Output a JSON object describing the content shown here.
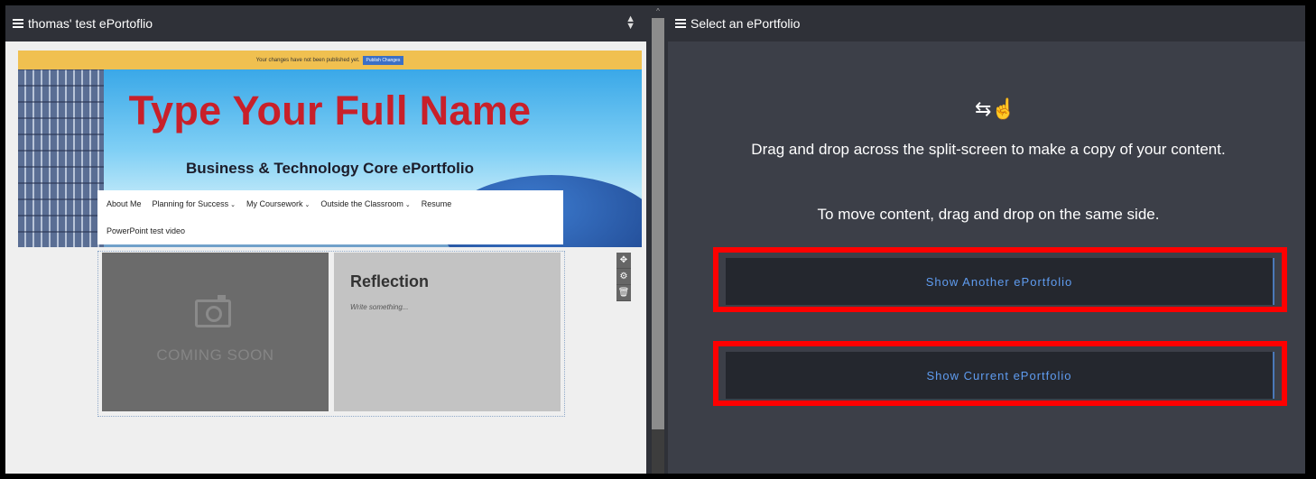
{
  "left_pane": {
    "title": "thomas' test ePortoflio",
    "publish_message": "Your changes have not been published yet.",
    "publish_button": "Publish Changes",
    "hero_title": "Type Your Full Name",
    "hero_subtitle": "Business & Technology Core ePortfolio",
    "nav": [
      {
        "label": "About Me",
        "dropdown": false
      },
      {
        "label": "Planning for Success",
        "dropdown": true
      },
      {
        "label": "My Coursework",
        "dropdown": true
      },
      {
        "label": "Outside the Classroom",
        "dropdown": true
      },
      {
        "label": "Resume",
        "dropdown": false
      },
      {
        "label": "PowerPoint test video",
        "dropdown": false
      }
    ],
    "image_placeholder": "COMING SOON",
    "reflection_title": "Reflection",
    "reflection_placeholder": "Write something..."
  },
  "right_pane": {
    "title": "Select an ePortfolio",
    "instruction_1": "Drag and drop across the split-screen to make a copy of your content.",
    "instruction_2": "To move content, drag and drop on the same side.",
    "button_another": "Show Another ePortfolio",
    "button_current": "Show Current ePortfolio"
  },
  "colors": {
    "highlight": "#ff0000",
    "link_blue": "#5f9cf0",
    "hero_title_red": "#c8202a",
    "publish_bar": "#f0c050"
  }
}
